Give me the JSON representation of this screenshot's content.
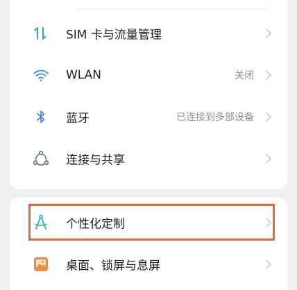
{
  "colors": {
    "background": "#f1f1f1",
    "card": "#ffffff",
    "accent_teal": "#2fb0a7",
    "bluetooth_blue": "#4a86d0",
    "highlight_orange": "#e06a3c",
    "wallpaper_icon": "#e98b45",
    "label_text": "#1e1e1e",
    "secondary_text": "#8e8e8e",
    "chevron": "#c4c4c4"
  },
  "settings": {
    "items": [
      {
        "id": "sim",
        "icon": "data-arrows-icon",
        "label": "SIM 卡与流量管理",
        "value": ""
      },
      {
        "id": "wlan",
        "icon": "wifi-icon",
        "label": "WLAN",
        "value": "关闭"
      },
      {
        "id": "bluetooth",
        "icon": "bluetooth-icon",
        "label": "蓝牙",
        "value": "已连接到多部设备"
      },
      {
        "id": "connection",
        "icon": "share-network-icon",
        "label": "连接与共享",
        "value": ""
      },
      {
        "id": "personalization",
        "icon": "compass-icon",
        "label": "个性化定制",
        "value": "",
        "highlighted": true
      },
      {
        "id": "desktop",
        "icon": "wallpaper-icon",
        "label": "桌面、锁屏与息屏",
        "value": ""
      }
    ]
  }
}
